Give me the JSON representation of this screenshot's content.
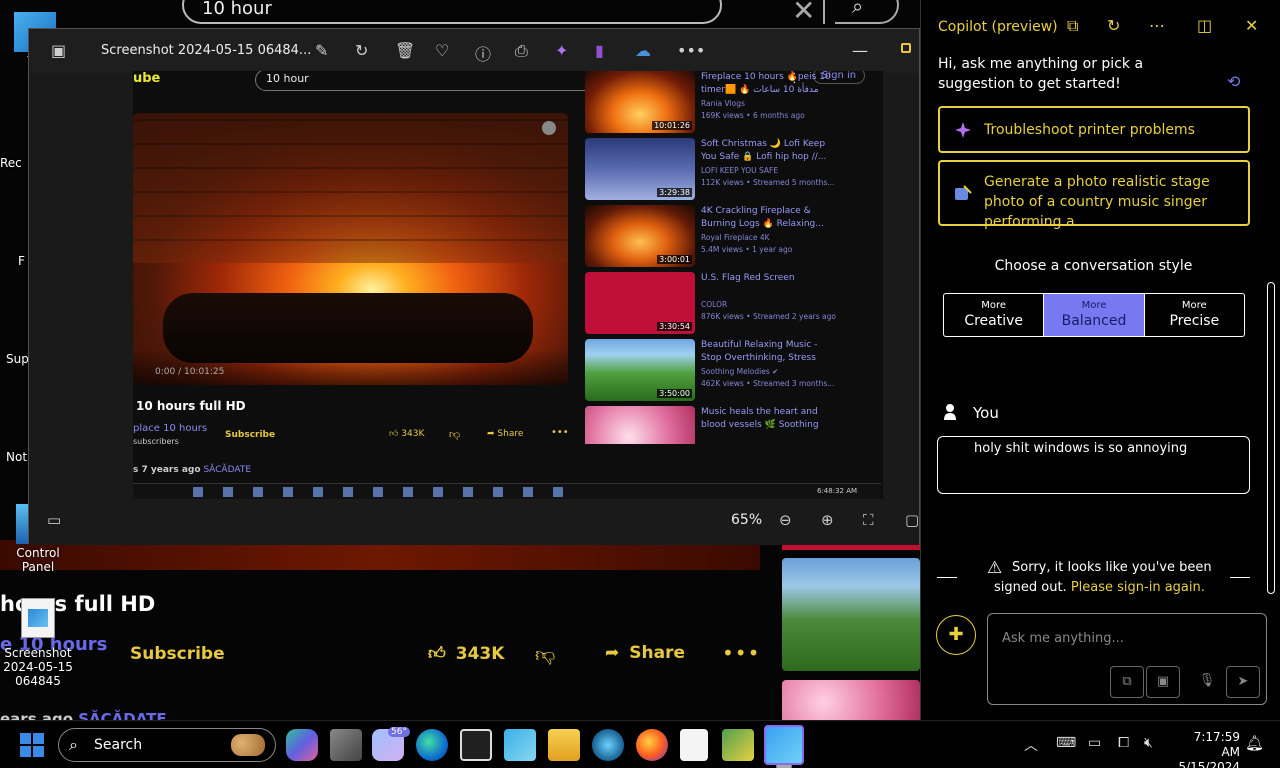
{
  "background": {
    "search_query": "10 hour",
    "video_title": "hours full HD",
    "channel": "e 10 hours",
    "subscribe": "Subscribe",
    "likes": "343K",
    "share": "Share",
    "age": "ears ago",
    "tag": "SĂCĂDATE"
  },
  "desktop": {
    "this_pc": "Th",
    "control_panel": "Control Panel",
    "screenshot_file": "Screenshot 2024-05-15 064845",
    "side_fragments": [
      "Rec",
      "F",
      "Sup",
      "Not"
    ]
  },
  "photos": {
    "file_name": "Screenshot 2024-05-15 06484...",
    "zoom": "65%",
    "image": {
      "logo": "ube",
      "search_query": "10 hour",
      "sign_in": "Sign in",
      "video_time": "0:00 / 10:01:25",
      "title": "10 hours full HD",
      "channel": "place 10 hours",
      "subscribers": "subscribers",
      "subscribe": "Subscribe",
      "likes": "343K",
      "share": "Share",
      "age": "s  7 years ago",
      "tag": "SĂCĂDATE",
      "clock": "6:48:32 AM",
      "recommendations": [
        {
          "title": "Fireplace 10 hours 🔥peis 10 timer🟧 🔥 مدفأة 10 ساعات",
          "channel": "Rania Vlogs",
          "meta": "169K views • 6 months ago",
          "duration": "10:01:26"
        },
        {
          "title": "Soft Christmas 🌙 Lofi Keep You Safe 🔒 Lofi hip hop //...",
          "channel": "LOFI KEEP YOU SAFE",
          "meta": "112K views • Streamed 5 months...",
          "duration": "3:29:38"
        },
        {
          "title": "4K Crackling Fireplace & Burning Logs 🔥 Relaxing...",
          "channel": "Royal Fireplace 4K",
          "meta": "5.4M views • 1 year ago",
          "duration": "3:00:01"
        },
        {
          "title": "U.S. Flag Red Screen",
          "channel": "COLOR",
          "meta": "876K views • Streamed 2 years ago",
          "duration": "3:30:54"
        },
        {
          "title": "Beautiful Relaxing Music - Stop Overthinking, Stress Relief...",
          "channel": "Soothing Melodies ✔",
          "meta": "462K views • Streamed 3 months...",
          "duration": "3:50:00"
        },
        {
          "title": "Music heals the heart and blood vessels 🌿 Soothing music...",
          "channel": "",
          "meta": "",
          "duration": ""
        }
      ]
    }
  },
  "copilot": {
    "title": "Copilot (preview)",
    "greeting": "Hi, ask me anything or pick a suggestion to get started!",
    "suggestions": [
      "Troubleshoot printer problems",
      "Generate a photo realistic stage photo of a country music singer performing a..."
    ],
    "style_label": "Choose a conversation style",
    "styles": [
      {
        "more": "More",
        "name": "Creative"
      },
      {
        "more": "More",
        "name": "Balanced"
      },
      {
        "more": "More",
        "name": "Precise"
      }
    ],
    "active_style": "Balanced",
    "you_label": "You",
    "user_message": "holy shit windows is so annoying",
    "warning_pre": "Sorry, it looks like you've been signed out.",
    "warning_link": "Please sign-in again.",
    "input_placeholder": "Ask me anything..."
  },
  "taskbar": {
    "search_label": "Search",
    "weather_badge": "56°",
    "time": "7:17:59 AM",
    "date": "5/15/2024"
  },
  "colors": {
    "accent_yellow": "#e8d040",
    "accent_purple": "#7878f0"
  }
}
